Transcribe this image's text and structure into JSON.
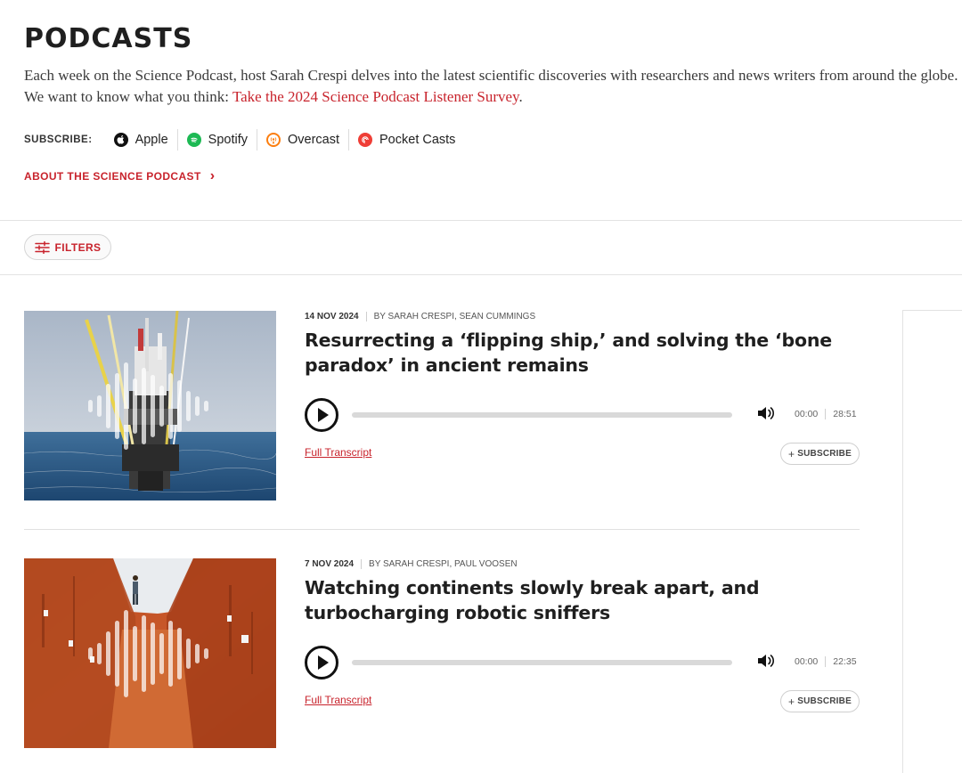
{
  "header": {
    "title": "PODCASTS",
    "intro_text": "Each week on the Science Podcast, host Sarah Crespi delves into the latest scientific discoveries with researchers and news writers from around the globe. We want to know what you think: ",
    "survey_link": "Take the 2024 Science Podcast Listener Survey",
    "intro_end": "."
  },
  "subscribe": {
    "label": "SUBSCRIBE:",
    "platforms": [
      {
        "name": "Apple",
        "icon": "apple-icon"
      },
      {
        "name": "Spotify",
        "icon": "spotify-icon"
      },
      {
        "name": "Overcast",
        "icon": "overcast-icon"
      },
      {
        "name": "Pocket Casts",
        "icon": "pocket-casts-icon"
      }
    ]
  },
  "about_link": "ABOUT THE SCIENCE PODCAST",
  "filters_label": "FILTERS",
  "episodes": [
    {
      "date": "14 NOV 2024",
      "byline": "BY SARAH CRESPI, SEAN CUMMINGS",
      "title": "Resurrecting a ‘flipping ship,’ and solving the ‘bone paradox’ in ancient remains",
      "current_time": "00:00",
      "duration": "28:51",
      "progress": 0,
      "transcript_label": "Full Transcript",
      "subscribe_label": "SUBSCRIBE"
    },
    {
      "date": "7 NOV 2024",
      "byline": "BY SARAH CRESPI, PAUL VOOSEN",
      "title": "Watching continents slowly break apart, and turbocharging robotic sniffers",
      "current_time": "00:00",
      "duration": "22:35",
      "progress": 0,
      "transcript_label": "Full Transcript",
      "subscribe_label": "SUBSCRIBE"
    }
  ],
  "colors": {
    "accent": "#c8232c",
    "text": "#1f1f1f"
  }
}
